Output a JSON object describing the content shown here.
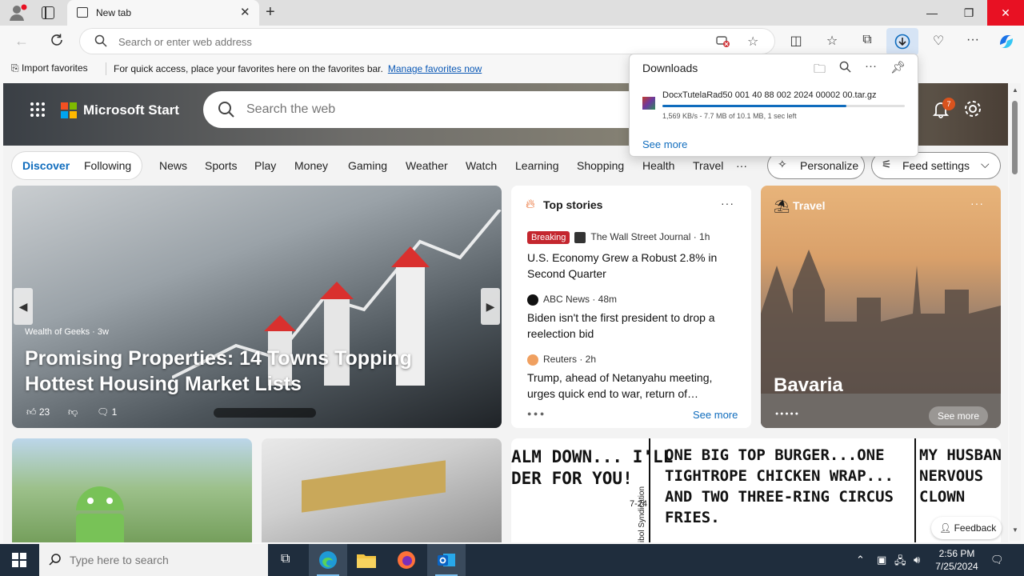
{
  "browser": {
    "tab_title": "New tab",
    "address_placeholder": "Search or enter web address"
  },
  "favorites_bar": {
    "import_label": "Import favorites",
    "hint_text": "For quick access, place your favorites here on the favorites bar.",
    "manage_link": "Manage favorites now"
  },
  "downloads": {
    "title": "Downloads",
    "file_name": "DocxTutelaRad50 001 40 88 002 2024 00002 00.tar.gz",
    "status": "1,569 KB/s - 7.7 MB of 10.1 MB, 1 sec left",
    "progress_fraction": 0.76,
    "see_more": "See more"
  },
  "start": {
    "brand": "Microsoft Start",
    "search_placeholder": "Search the web",
    "notification_count": "7"
  },
  "nav": {
    "discover": "Discover",
    "following": "Following",
    "categories": [
      "News",
      "Sports",
      "Play",
      "Money",
      "Gaming",
      "Weather",
      "Watch",
      "Learning",
      "Shopping",
      "Health",
      "Travel"
    ],
    "personalize": "Personalize",
    "feed_settings": "Feed settings"
  },
  "hero": {
    "source": "Wealth of Geeks · 3w",
    "title": "Promising Properties: 14 Towns Topping Hottest Housing Market Lists",
    "likes": "23",
    "comments": "1"
  },
  "top_stories": {
    "title": "Top stories",
    "breaking_label": "Breaking",
    "stories": [
      {
        "source": "The Wall Street Journal · 1h",
        "headline": "U.S. Economy Grew a Robust 2.8% in Second Quarter"
      },
      {
        "source": "ABC News · 48m",
        "headline": "Biden isn't the first president to drop a reelection bid"
      },
      {
        "source": "Reuters · 2h",
        "headline": "Trump, ahead of Netanyahu meeting, urges quick end to war, return of…"
      }
    ],
    "see_more": "See more"
  },
  "travel": {
    "label": "Travel",
    "place": "Bavaria",
    "see_more": "See more"
  },
  "comic": {
    "panel1": "ALM DOWN... I'LL\nDER FOR YOU!",
    "credit": "ibol Syndication",
    "date": "7-24",
    "panel2": "ONE BIG TOP BURGER...ONE\nTIGHTROPE CHICKEN WRAP...\nAND TWO THREE-RING CIRCUS\nFRIES.",
    "panel3": "MY HUSBAN\nNERVOUS\nCLOWN"
  },
  "feedback": "Feedback",
  "taskbar": {
    "search_placeholder": "Type here to search",
    "time": "2:56 PM",
    "date": "7/25/2024"
  },
  "colors": {
    "accent": "#0f6cbd",
    "breaking": "#c4262e",
    "close_button": "#e81123",
    "taskbar": "#1f2d3d"
  }
}
